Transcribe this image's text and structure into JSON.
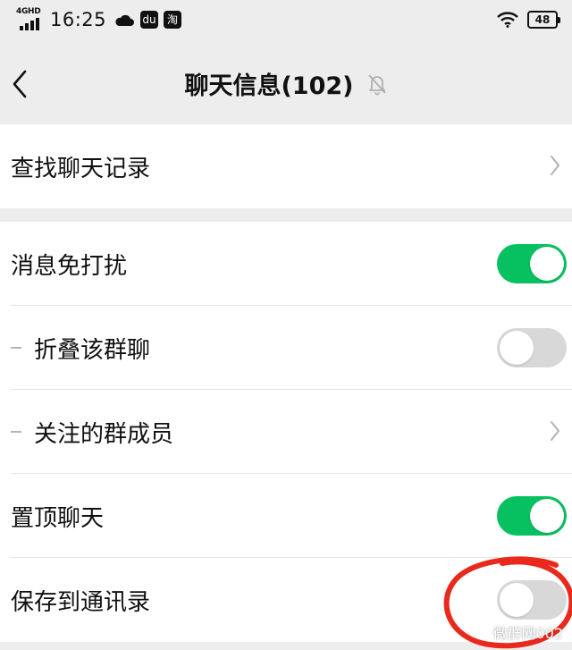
{
  "status_bar": {
    "network": "4GHD",
    "time": "16:25",
    "icons": [
      "cloud-icon",
      "app-icon-baidu",
      "app-icon-taobao"
    ],
    "battery": "48",
    "wifi": "wifi-icon"
  },
  "nav": {
    "title": "聊天信息(102)",
    "back_icon": "back-chevron-icon",
    "mute_icon": "bell-off-icon"
  },
  "rows": {
    "search_history": "查找聊天记录",
    "mute": "消息免打扰",
    "fold": "折叠该群聊",
    "followed_members": "关注的群成员",
    "pin": "置顶聊天",
    "save_contacts": "保存到通讯录"
  },
  "toggles": {
    "mute": true,
    "fold": false,
    "pin": true,
    "save_contacts": false
  },
  "colors": {
    "toggle_on": "#07c160",
    "toggle_off": "#d8d8d8",
    "page_bg": "#ededed",
    "annotation": "#e8291c"
  },
  "watermark": {
    "text": "微群网002"
  }
}
